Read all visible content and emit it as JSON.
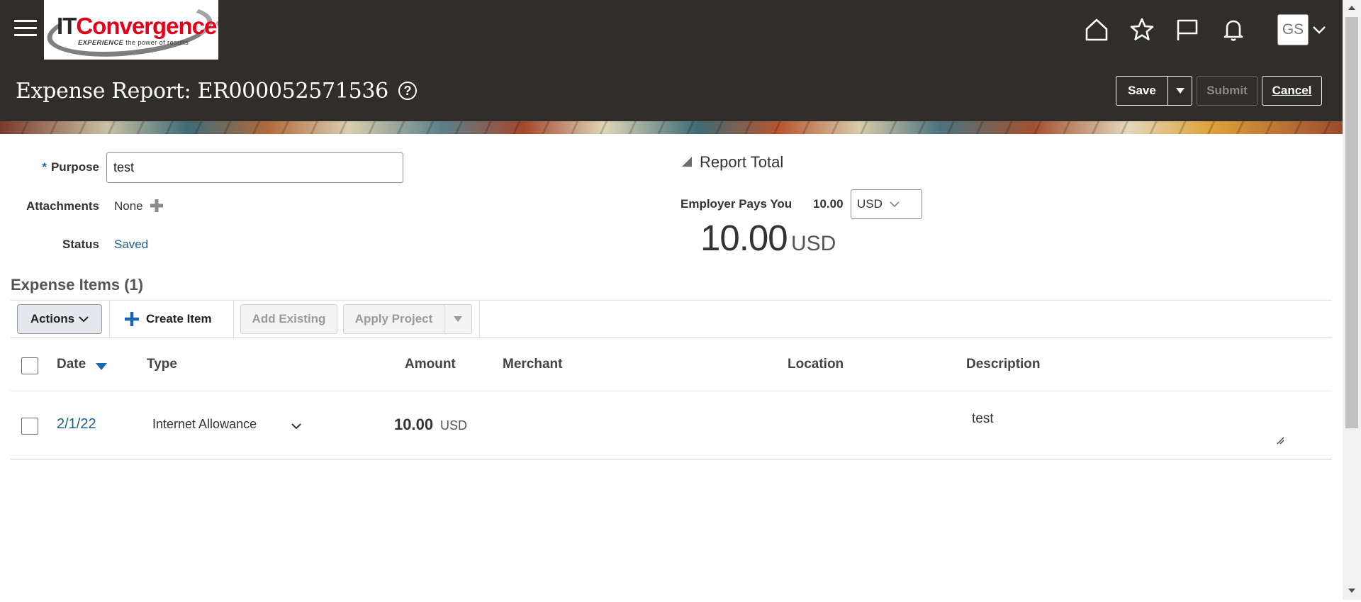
{
  "header": {
    "logo": {
      "brand_it": "IT",
      "brand_rest": "Convergence",
      "trademark": "®",
      "tagline_bold": "EXPERIENCE",
      "tagline_rest": " the power of results"
    },
    "nav_icons": [
      "home-icon",
      "favorites-star-icon",
      "flag-icon",
      "notifications-bell-icon"
    ],
    "user_initials": "GS",
    "page_title": "Expense Report: ER000052571536",
    "help_symbol": "?",
    "buttons": {
      "save": "Save",
      "submit": "Submit",
      "cancel": "Cancel"
    }
  },
  "form": {
    "purpose": {
      "label": "Purpose",
      "required_marker": "*",
      "value": "test"
    },
    "attachments": {
      "label": "Attachments",
      "value": "None"
    },
    "status": {
      "label": "Status",
      "value": "Saved"
    }
  },
  "report_total": {
    "title": "Report Total",
    "employer_pays_label": "Employer Pays You",
    "employer_pays_amount": "10.00",
    "currency_selected": "USD",
    "total_amount": "10.00",
    "total_currency": "USD"
  },
  "expense_items": {
    "title": "Expense Items (1)",
    "toolbar": {
      "actions": "Actions",
      "create_item": "Create Item",
      "add_existing": "Add Existing",
      "apply_project": "Apply Project"
    },
    "columns": {
      "date": "Date",
      "type": "Type",
      "amount": "Amount",
      "merchant": "Merchant",
      "location": "Location",
      "description": "Description"
    },
    "sort": {
      "column": "date",
      "direction": "descending"
    },
    "rows": [
      {
        "date": "2/1/22",
        "type": "Internet Allowance",
        "amount": "10.00",
        "currency": "USD",
        "merchant": "",
        "location": "",
        "description": "test"
      }
    ]
  },
  "colors": {
    "header_bg": "#312d2a",
    "link": "#1b5e8c",
    "accent_blue": "#1a66b3",
    "logo_red": "#e4001b"
  }
}
